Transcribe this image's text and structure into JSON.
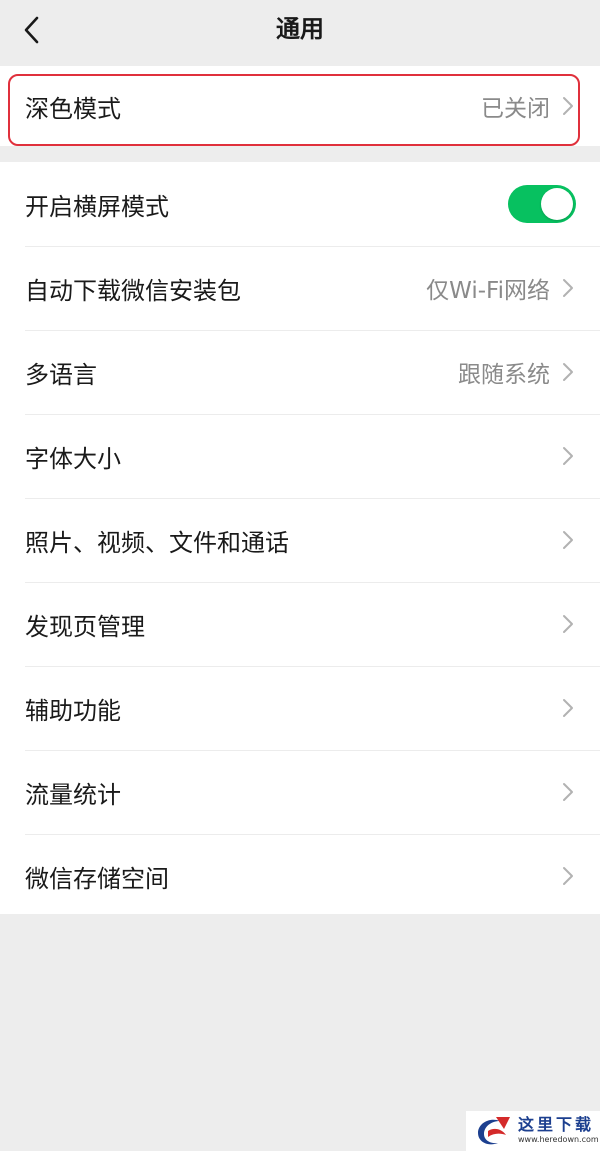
{
  "nav": {
    "title": "通用",
    "back_icon": "chevron-left-icon"
  },
  "group1": {
    "dark_mode": {
      "label": "深色模式",
      "value": "已关闭"
    }
  },
  "group2": {
    "landscape": {
      "label": "开启横屏模式",
      "enabled": true
    },
    "auto_download": {
      "label": "自动下载微信安装包",
      "value": "仅Wi-Fi网络"
    },
    "language": {
      "label": "多语言",
      "value": "跟随系统"
    },
    "font_size": {
      "label": "字体大小"
    },
    "media": {
      "label": "照片、视频、文件和通话"
    },
    "discover": {
      "label": "发现页管理"
    },
    "accessibility": {
      "label": "辅助功能"
    },
    "traffic": {
      "label": "流量统计"
    },
    "storage": {
      "label": "微信存储空间"
    }
  },
  "watermark": {
    "name": "这里下载",
    "url": "www.heredown.com"
  },
  "colors": {
    "toggle_on": "#07c160",
    "highlight": "#e0303c",
    "background": "#ededed"
  }
}
